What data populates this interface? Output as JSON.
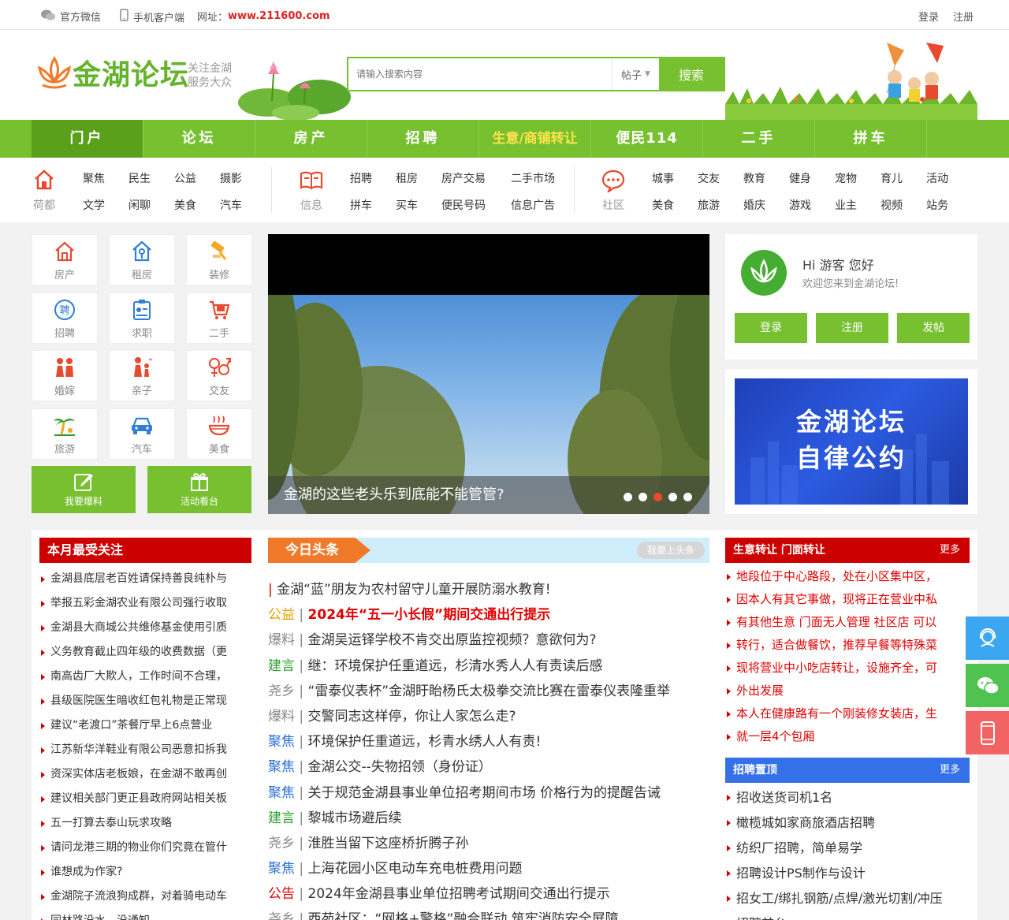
{
  "topbar": {
    "wechat": "官方微信",
    "mobile": "手机客户端",
    "url_label": "网址：",
    "url": "www.211600.com",
    "login": "登录",
    "register": "注册"
  },
  "header": {
    "logo_text": "金湖论坛",
    "slogan_line1": "关注金湖",
    "slogan_line2": "服务大众",
    "search_placeholder": "请输入搜索内容",
    "search_scope": "帖子",
    "search_button": "搜索"
  },
  "nav": [
    "门户",
    "论坛",
    "房产",
    "招聘",
    "生意/商铺转让",
    "便民114",
    "二手",
    "拼车"
  ],
  "subnav": {
    "group1": {
      "label": "荷都",
      "row1": [
        "聚焦",
        "民生",
        "公益",
        "摄影"
      ],
      "row2": [
        "文学",
        "闲聊",
        "美食",
        "汽车"
      ]
    },
    "group2": {
      "label": "信息",
      "row1": [
        "招聘",
        "租房",
        "房产交易",
        "二手市场"
      ],
      "row2": [
        "拼车",
        "买车",
        "便民号码",
        "信息广告"
      ]
    },
    "group3": {
      "label": "社区",
      "row1": [
        "城事",
        "交友",
        "教育",
        "健身",
        "宠物",
        "育儿",
        "活动"
      ],
      "row2": [
        "美食",
        "旅游",
        "婚庆",
        "游戏",
        "业主",
        "视频",
        "站务"
      ]
    }
  },
  "categories": [
    "房产",
    "租房",
    "装修",
    "招聘",
    "求职",
    "二手",
    "婚嫁",
    "亲子",
    "交友",
    "旅游",
    "汽车",
    "美食"
  ],
  "category_icons": [
    "house-icon",
    "rent-icon",
    "brush-icon",
    "recruit-icon",
    "resume-icon",
    "cart-icon",
    "couple-icon",
    "family-icon",
    "gender-icon",
    "palm-icon",
    "car-icon",
    "bowl-icon"
  ],
  "quick_buttons": [
    "我要爆料",
    "活动看台"
  ],
  "slider": {
    "caption": "金湖的这些老头乐到底能不能管管?",
    "dots": 5,
    "active_dot": 3
  },
  "user": {
    "hi": "Hi 游客 您好",
    "welcome": "欢迎您来到金湖论坛!",
    "login": "登录",
    "register": "注册",
    "post": "发帖"
  },
  "banner": {
    "line1": "金湖论坛",
    "line2": "自律公约"
  },
  "monthly": {
    "title": "本月最受关注",
    "items": [
      "金湖县底层老百姓请保持善良纯朴与",
      "举报五彩金湖农业有限公司强行收取",
      "金湖县大商城公共维修基金使用引质",
      "义务教育截止四年级的收费数据（更",
      "南高齿厂大欺人，工作时间不合理，",
      "县级医院医生暗收红包礼物是正常现",
      "建议“老渡口”茶餐厅早上6点营业",
      "江苏新华洋鞋业有限公司恶意扣拆我",
      "资深实体店老板娘，在金湖不敢再创",
      "建议相关部门更正县政府网站相关板",
      "五一打算去泰山玩求攻略",
      "请问龙港三期的物业你们究竟在管什",
      "谁想成为作家?",
      "金湖院子流浪狗成群，对着骑电动车",
      "同林路没水，没通知"
    ]
  },
  "headlines": {
    "title": "今日头条",
    "action": "我要上头条",
    "items": [
      {
        "tag": "",
        "text": "金湖“蓝”朋友为农村留守儿童开展防溺水教育!",
        "tag_color": "#c00",
        "text_color": "#333",
        "bold": false
      },
      {
        "tag": "公益",
        "text": "2024年“五一小长假”期间交通出行提示",
        "tag_color": "#e8a000",
        "text_color": "#e00000",
        "bold": true
      },
      {
        "tag": "爆料",
        "text": "金湖吴运铎学校不肯交出原监控视频？意欲何为?",
        "tag_color": "#888",
        "text_color": "#333",
        "bold": false
      },
      {
        "tag": "建言",
        "text": "继：环境保护任重道远，杉清水秀人人有责读后感",
        "tag_color": "#2a9d2a",
        "text_color": "#333",
        "bold": false
      },
      {
        "tag": "尧乡",
        "text": " “雷泰仪表杯”金湖盱眙杨氏太极拳交流比赛在雷泰仪表隆重举",
        "tag_color": "#888",
        "text_color": "#333",
        "bold": false
      },
      {
        "tag": "爆料",
        "text": "交警同志这样停，你让人家怎么走?",
        "tag_color": "#888",
        "text_color": "#333",
        "bold": false
      },
      {
        "tag": "聚焦",
        "text": "环境保护任重道远，杉青水绣人人有责!",
        "tag_color": "#2a6fd6",
        "text_color": "#333",
        "bold": false
      },
      {
        "tag": "聚焦",
        "text": "金湖公交--失物招领（身份证）",
        "tag_color": "#2a6fd6",
        "text_color": "#333",
        "bold": false
      },
      {
        "tag": "聚焦",
        "text": "关于规范金湖县事业单位招考期间市场 价格行为的提醒告诫",
        "tag_color": "#2a6fd6",
        "text_color": "#333",
        "bold": false
      },
      {
        "tag": "建言",
        "text": "黎城市场避后续",
        "tag_color": "#2a9d2a",
        "text_color": "#333",
        "bold": false
      },
      {
        "tag": "尧乡",
        "text": "淮胜当留下这座桥折腾子孙",
        "tag_color": "#888",
        "text_color": "#333",
        "bold": false
      },
      {
        "tag": "聚焦",
        "text": "上海花园小区电动车充电桩费用问题",
        "tag_color": "#2a6fd6",
        "text_color": "#333",
        "bold": false
      },
      {
        "tag": "公告",
        "text": "2024年金湖县事业单位招聘考试期间交通出行提示",
        "tag_color": "#e00000",
        "text_color": "#333",
        "bold": false
      },
      {
        "tag": "尧乡",
        "text": "西苑社区：“网格+警格”融合联动 筑牢消防安全屏障",
        "tag_color": "#888",
        "text_color": "#333",
        "bold": false
      }
    ]
  },
  "business": {
    "title": "生意转让 门面转让",
    "more": "更多",
    "items": [
      "地段位于中心路段，处在小区集中区，",
      "因本人有其它事做，现将正在营业中私",
      "有其他生意 门面无人管理 社区店 可以",
      "转行，适合做餐饮，推荐早餐等特殊菜",
      "现将营业中小吃店转让，设施齐全，可",
      "外出发展",
      "本人在健康路有一个刚装修女装店，生",
      "就一层4个包厢"
    ]
  },
  "jobs": {
    "title": "招聘置顶",
    "more": "更多",
    "items": [
      "招收送货司机1名",
      "橄榄城如家商旅酒店招聘",
      "纺织厂招聘，简单易学",
      "招聘设计PS制作与设计",
      "招女工/绑扎钢筋/点焊/激光切割/冲压",
      "招聘前台"
    ]
  },
  "colors": {
    "green": "#77c030",
    "red": "#cc0000",
    "orange": "#f07a2a",
    "blue": "#3470e8"
  }
}
